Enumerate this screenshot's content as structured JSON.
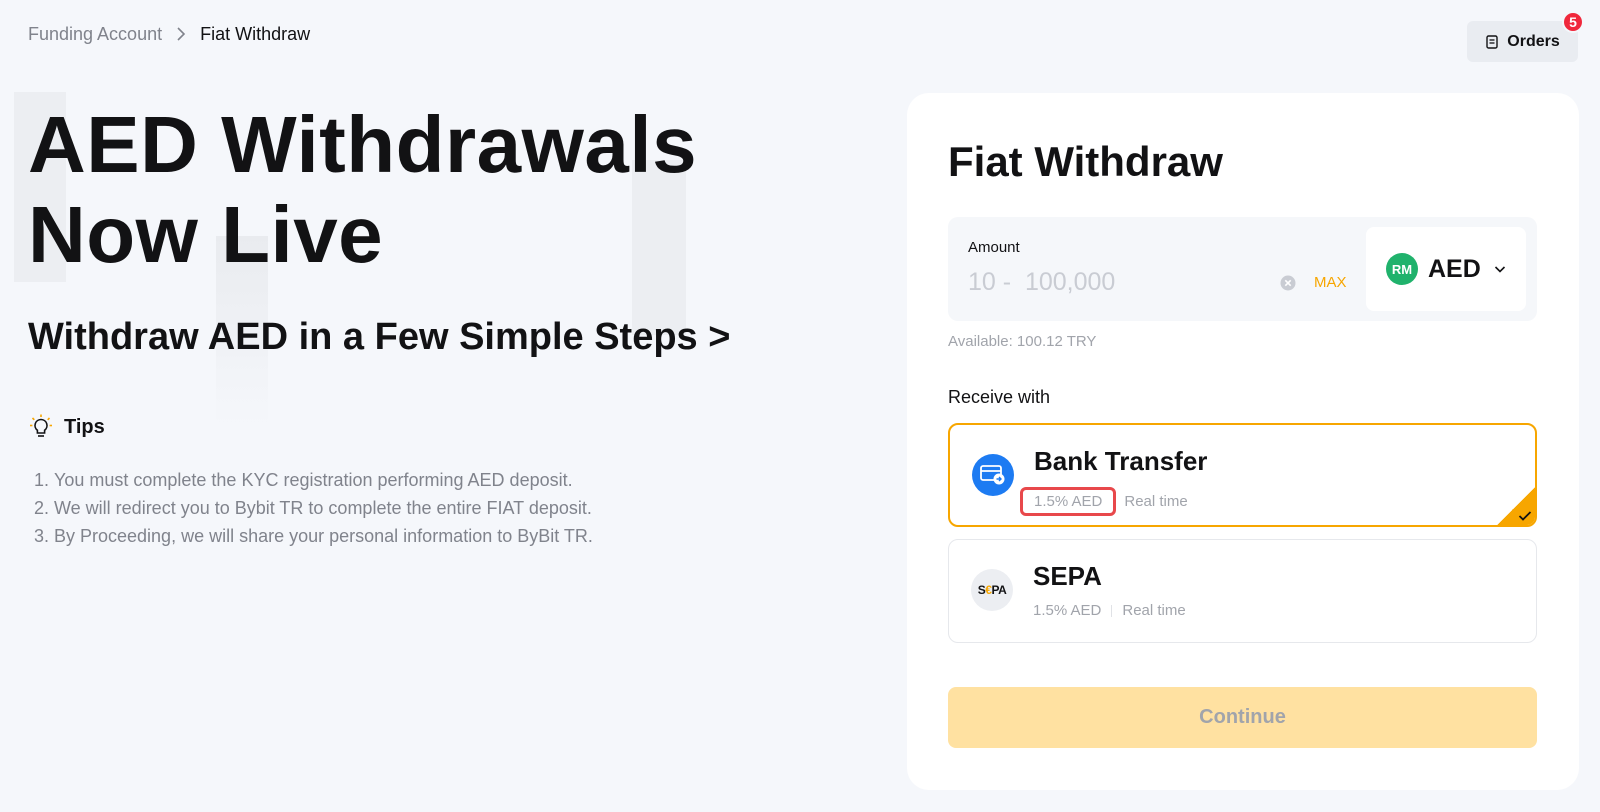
{
  "breadcrumb": {
    "parent": "Funding Account",
    "current": "Fiat Withdraw"
  },
  "orders": {
    "label": "Orders",
    "badge": "5"
  },
  "hero": {
    "title_line1": "AED Withdrawals",
    "title_line2": "Now Live",
    "subtitle": "Withdraw AED in a Few Simple Steps >"
  },
  "tips": {
    "title": "Tips",
    "items": [
      {
        "num": "1.",
        "text": "You must complete the KYC registration performing AED deposit."
      },
      {
        "num": "2.",
        "text": "We will redirect you to Bybit TR to complete the entire FIAT deposit."
      },
      {
        "num": "3.",
        "text": "By Proceeding, we will share your personal information to ByBit TR."
      }
    ]
  },
  "panel": {
    "title": "Fiat Withdraw",
    "amount": {
      "label": "Amount",
      "value": "",
      "placeholder": "10 -  100,000",
      "max_label": "MAX"
    },
    "currency": {
      "logo_text": "RM",
      "code": "AED"
    },
    "available": "Available: 100.12 TRY",
    "receive_label": "Receive with",
    "methods": [
      {
        "name": "Bank Transfer",
        "fee": "1.5% AED",
        "speed": "Real time",
        "selected": true,
        "icon": "bank-card-icon"
      },
      {
        "name": "SEPA",
        "fee": "1.5% AED",
        "speed": "Real time",
        "selected": false,
        "icon": "sepa-logo",
        "logo_text": {
          "s": "S",
          "e": "€",
          "rest": "PA"
        }
      }
    ],
    "continue_label": "Continue"
  },
  "colors": {
    "accent": "#f7a600",
    "background": "#f5f7fb",
    "panel": "#ffffff",
    "badge": "#f0283c",
    "highlight": "#e8484b",
    "continue_disabled": "#ffe1a1",
    "bank_icon": "#1d7bf2",
    "currency_logo": "#20b26c"
  }
}
